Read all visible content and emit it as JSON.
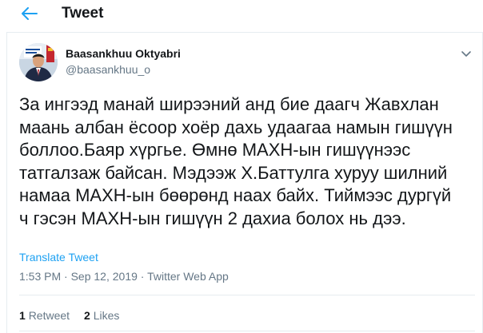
{
  "header": {
    "title": "Tweet",
    "back_icon": "arrow-left-icon"
  },
  "author": {
    "name": "Baasankhuu Oktyabri",
    "handle": "@baasankhuu_o"
  },
  "tweet": {
    "text": "За ингээд манай ширээний анд бие даагч Жавхлан\nмаань албан ёсоор хоёр дахь удаагаа намын гишүүн\nболлоо.Баяр хүргье. Өмнө МАХН-ын гишүүнээс\nтатгалзаж байсан. Мэдээж Х.Баттулга хуруу шилний\nнамаа МАХН-ын бөөрөнд наах байх. Тиймээс дургүй\nч гэсэн МАХН-ын гишүүн 2 дахиа болох нь дээ.",
    "translate_label": "Translate Tweet",
    "time": "1:53 PM",
    "separator": " · ",
    "date": "Sep 12, 2019",
    "source": "Twitter Web App"
  },
  "stats": {
    "retweets_count": "1",
    "retweets_label": "Retweet",
    "likes_count": "2",
    "likes_label": "Likes"
  },
  "colors": {
    "accent": "#1da1f2",
    "secondary_text": "#657786",
    "primary_text": "#14171a",
    "border": "#e6ecf0"
  }
}
